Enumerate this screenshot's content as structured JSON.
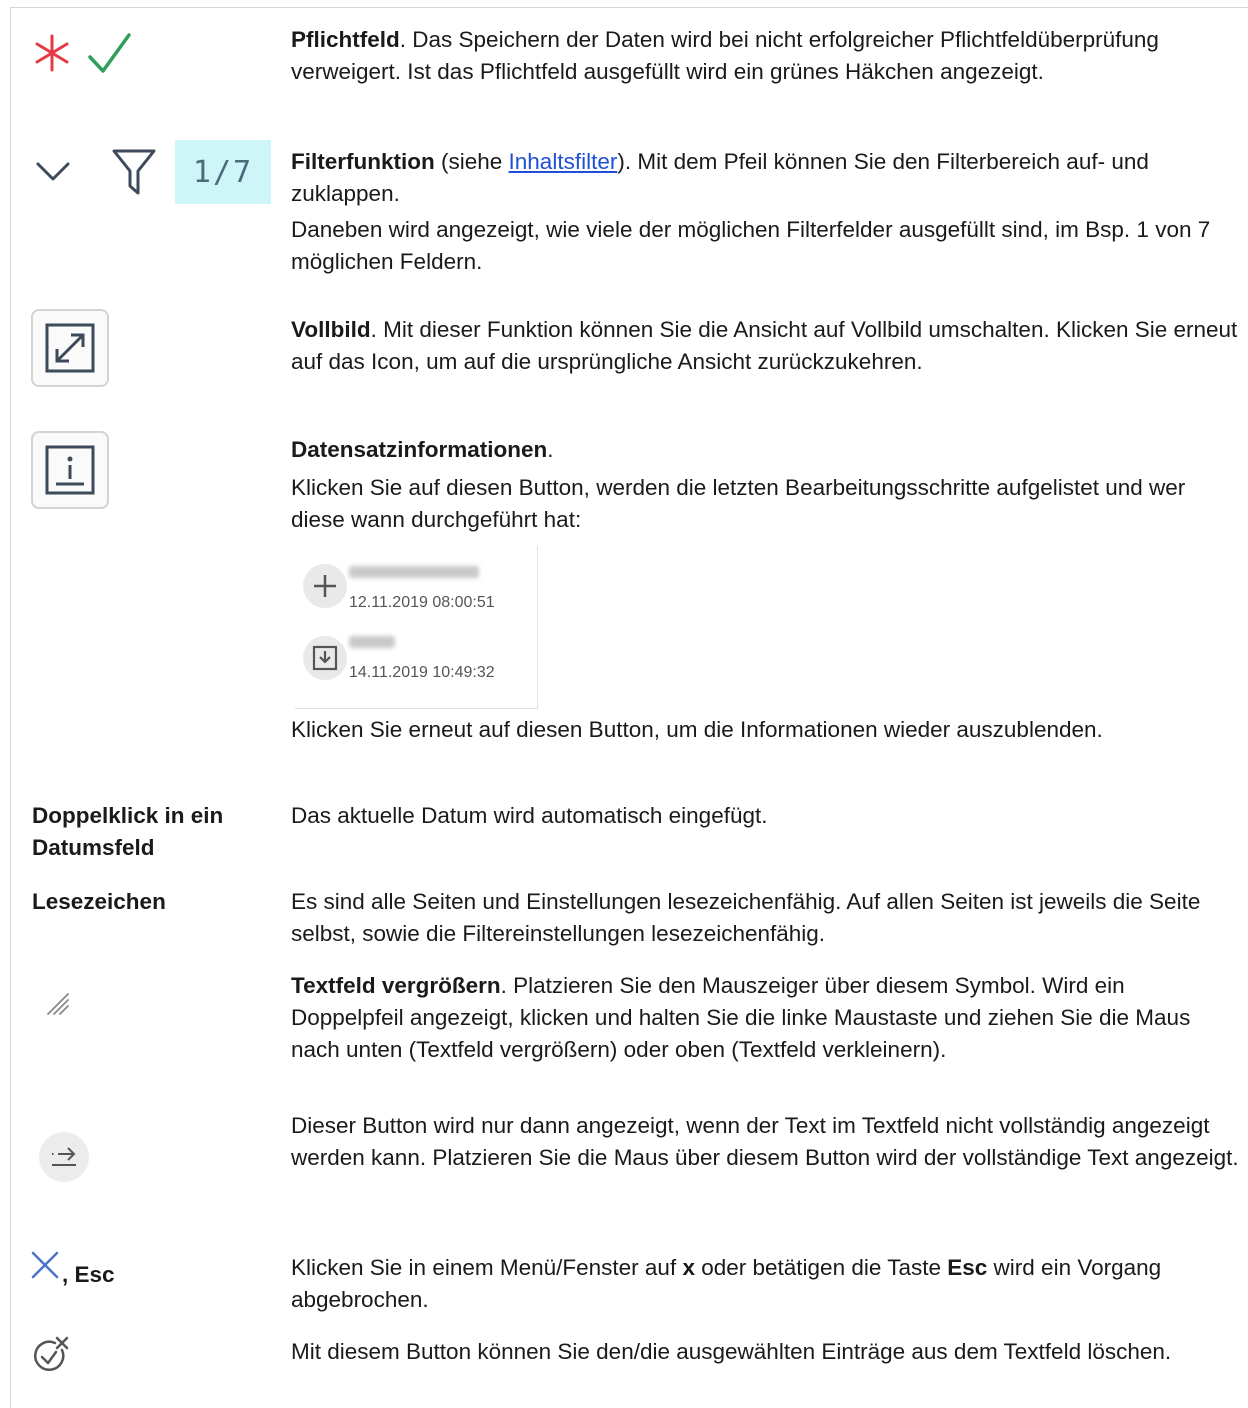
{
  "rows": {
    "pflichtfeld": {
      "title": "Pflichtfeld",
      "text": ". Das Speichern der Daten wird bei nicht erfolgreicher Pflichtfeldüberprüfung verweigert. Ist das Pflichtfeld ausgefüllt wird ein grünes Häkchen angezeigt."
    },
    "filter": {
      "badge": "1/7",
      "title": "Filterfunktion",
      "text_pre": " (siehe ",
      "link": "Inhaltsfilter",
      "text_post": "). Mit dem Pfeil können Sie den Filterbereich auf- und zuklappen.",
      "text2": "Daneben wird angezeigt, wie viele der möglichen Filterfelder ausgefüllt sind, im Bsp. 1 von 7 möglichen Feldern."
    },
    "vollbild": {
      "title": "Vollbild",
      "text": ". Mit dieser Funktion können Sie die Ansicht auf Vollbild umschalten. Klicken Sie erneut auf das Icon, um auf die ursprüngliche Ansicht zurückzukehren."
    },
    "datensatz": {
      "title": "Datensatzinformationen",
      "title_suffix": ".",
      "text": "Klicken Sie auf diesen Button, werden die letzten Bearbeitungsschritte aufgelistet und wer diese wann durchgeführt hat:",
      "history": [
        {
          "date": "12.11.2019 08:00:51"
        },
        {
          "date": "14.11.2019 10:49:32"
        }
      ],
      "text2": "Klicken Sie erneut auf diesen Button, um die Informationen wieder auszublenden."
    },
    "doppelklick": {
      "label": "Doppelklick in ein Datumsfeld",
      "text": "Das aktuelle Datum wird automatisch eingefügt."
    },
    "lesezeichen": {
      "label": "Lesezeichen",
      "text": "Es sind alle Seiten und Einstellungen lesezeichenfähig. Auf allen Seiten ist jeweils die Seite selbst, sowie die Filtereinstellungen lesezeichenfähig."
    },
    "textfeld": {
      "title": "Textfeld vergrößern",
      "text": ". Platzieren Sie den Mauszeiger über diesem Symbol. Wird ein Doppelpfeil angezeigt, klicken und halten Sie die linke Maustaste und ziehen Sie die Maus nach unten (Textfeld vergrößern) oder oben (Textfeld verkleinern)."
    },
    "mehr": {
      "text": "Dieser Button wird nur dann angezeigt, wenn der Text im Textfeld nicht vollständig angezeigt werden kann. Platzieren Sie die Maus über diesem Button wird der vollständige Text angezeigt."
    },
    "esc": {
      "label": ", Esc",
      "text_pre": "Klicken Sie in einem Menü/Fenster auf ",
      "bold1": "x",
      "text_mid": " oder betätigen die Taste ",
      "bold2": "Esc",
      "text_post": " wird ein Vorgang abgebrochen."
    },
    "loeschen": {
      "text": "Mit diesem Button können Sie den/die ausgewählten Einträge aus dem Textfeld löschen."
    }
  },
  "colors": {
    "required": "#e63946",
    "ok": "#2e9e5b",
    "icon": "#3c4a5a",
    "badge_bg": "#cef5f8",
    "link": "#1f4fd6"
  }
}
